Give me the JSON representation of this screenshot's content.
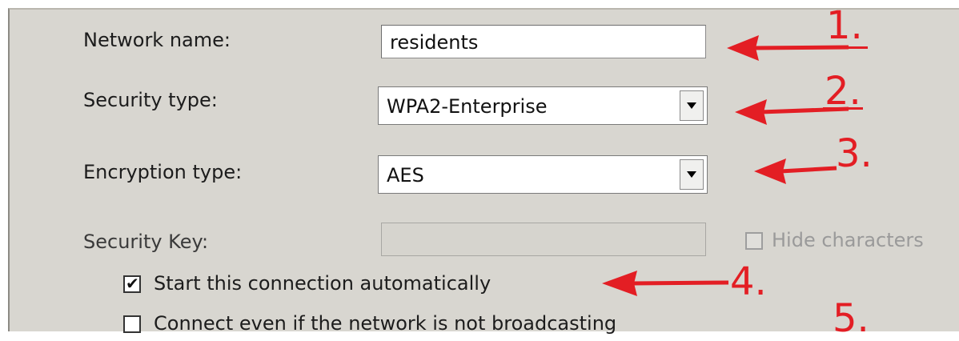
{
  "form": {
    "network_name_label": "Network name:",
    "network_name_value": "residents",
    "security_type_label": "Security type:",
    "security_type_value": "WPA2-Enterprise",
    "encryption_type_label": "Encryption type:",
    "encryption_type_value": "AES",
    "security_key_label": "Security Key:",
    "security_key_value": "",
    "hide_characters_label": "Hide characters",
    "hide_characters_checked": false,
    "start_automatically_label": "Start this connection automatically",
    "start_automatically_checked": true,
    "connect_not_broadcasting_label": "Connect even if the network is not broadcasting",
    "connect_not_broadcasting_checked": false
  },
  "annotations": {
    "step1": "1.",
    "step2": "2.",
    "step3": "3.",
    "step4": "4.",
    "step5": "5.",
    "color": "#e31e24"
  },
  "check_glyph": "✔"
}
